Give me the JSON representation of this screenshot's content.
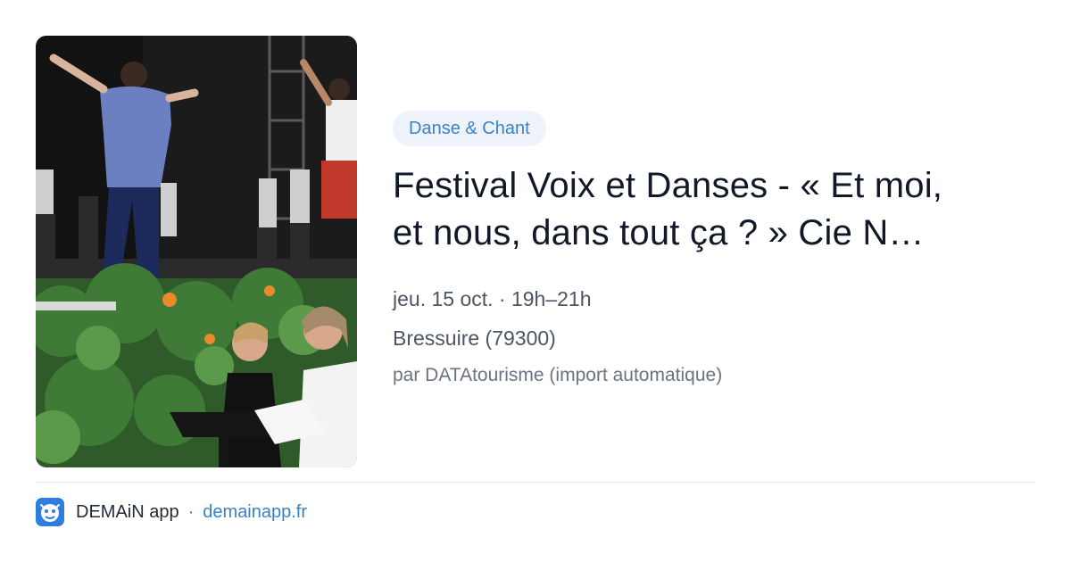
{
  "event": {
    "category": "Danse & Chant",
    "title_line1": "Festival Voix et Danses - « Et moi,",
    "title_line2": "et nous, dans tout ça ? » Cie N…",
    "datetime": "jeu. 15 oct. · 19h–21h",
    "location": "Bressuire (79300)",
    "source": "par DATAtourisme (import automatique)"
  },
  "footer": {
    "app_name": "DEMAiN app",
    "separator": "·",
    "domain": "demainapp.fr"
  },
  "colors": {
    "accent": "#3b82c4",
    "tag_bg": "#eef3fb",
    "title": "#111827"
  },
  "icons": {
    "app": "demain-app-icon"
  }
}
